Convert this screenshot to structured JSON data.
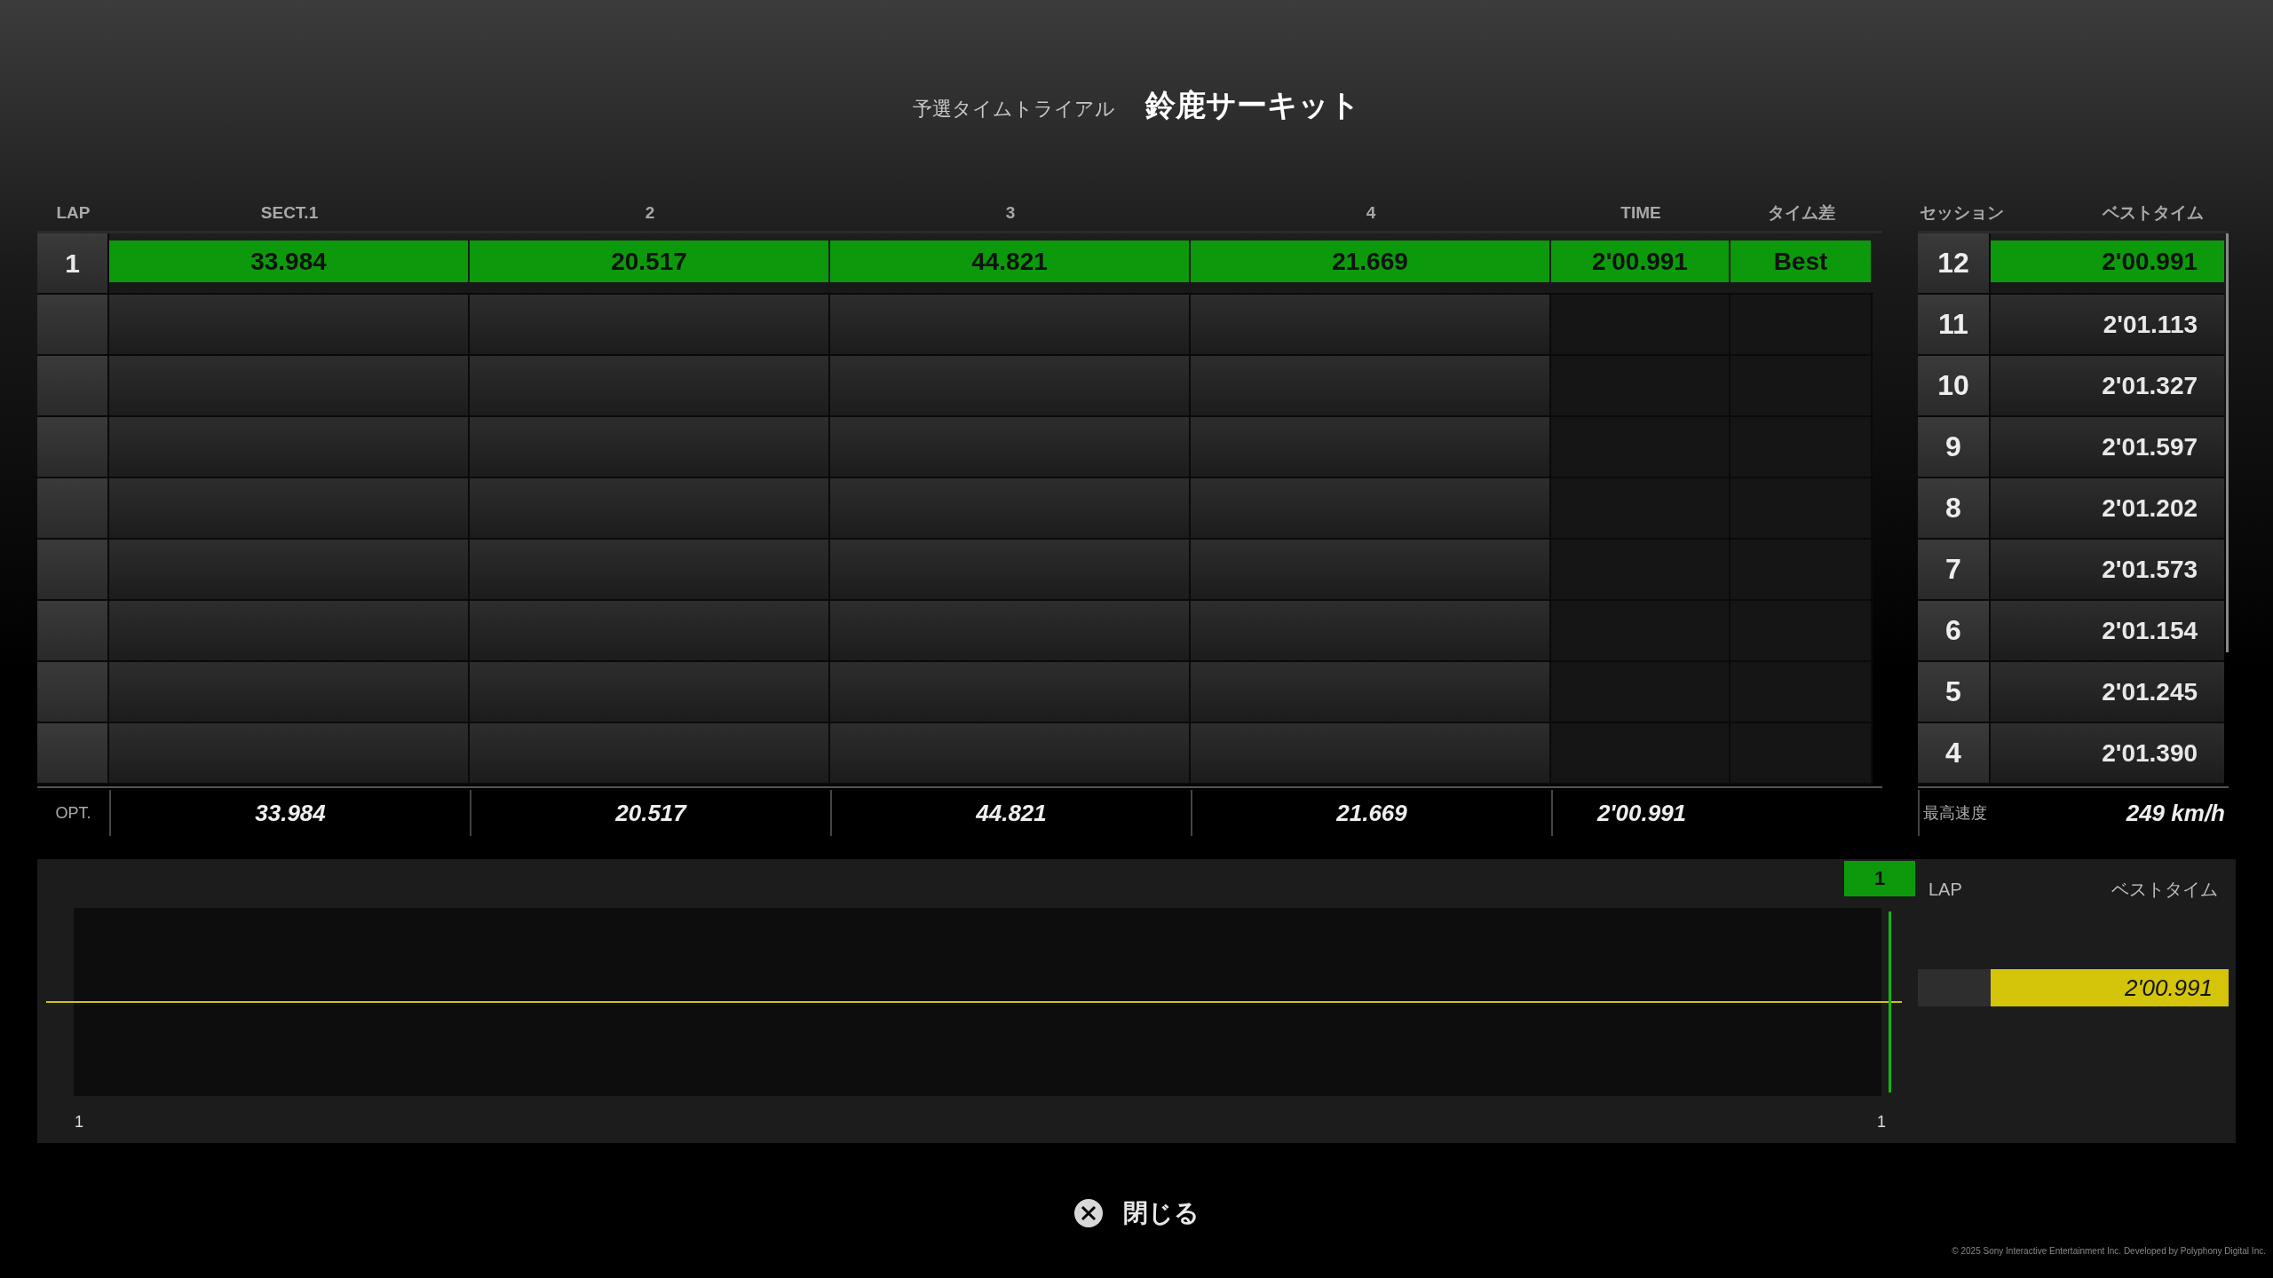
{
  "title": {
    "mode": "予選タイムトライアル",
    "track": "鈴鹿サーキット"
  },
  "lap_table": {
    "columns": [
      "LAP",
      "SECT.1",
      "2",
      "3",
      "4",
      "TIME",
      "タイム差"
    ],
    "rows": [
      {
        "kind": "lap",
        "lap": "1",
        "sectors": [
          "33.984",
          "20.517",
          "44.821",
          "21.669"
        ],
        "time": "2'00.991",
        "diff": "Best",
        "best": true
      },
      {
        "kind": "empty"
      },
      {
        "kind": "empty"
      },
      {
        "kind": "empty"
      },
      {
        "kind": "empty"
      },
      {
        "kind": "empty"
      },
      {
        "kind": "empty"
      },
      {
        "kind": "empty"
      },
      {
        "kind": "empty"
      }
    ],
    "optimal": {
      "label": "OPT.",
      "sectors": [
        "33.984",
        "20.517",
        "44.821",
        "21.669"
      ],
      "time": "2'00.991"
    }
  },
  "sessions": {
    "columns": [
      "セッション",
      "ベストタイム"
    ],
    "rows": [
      {
        "session": "12",
        "time": "2'00.991",
        "best": true
      },
      {
        "session": "11",
        "time": "2'01.113",
        "best": false
      },
      {
        "session": "10",
        "time": "2'01.327",
        "best": false
      },
      {
        "session": "9",
        "time": "2'01.597",
        "best": false
      },
      {
        "session": "8",
        "time": "2'01.202",
        "best": false
      },
      {
        "session": "7",
        "time": "2'01.573",
        "best": false
      },
      {
        "session": "6",
        "time": "2'01.154",
        "best": false
      },
      {
        "session": "5",
        "time": "2'01.245",
        "best": false
      },
      {
        "session": "4",
        "time": "2'01.390",
        "best": false
      }
    ],
    "top_speed": {
      "label": "最高速度",
      "value": "249 km/h"
    }
  },
  "lap_chart": {
    "marker": "1",
    "x_labels": [
      "1",
      "1"
    ],
    "legend": {
      "columns": [
        "LAP",
        "ベストタイム"
      ],
      "rows": [
        {
          "time": "2'00.991",
          "color": "#d4c40a"
        }
      ]
    }
  },
  "close_button": "閉じる",
  "copyright": "© 2025 Sony Interactive Entertainment Inc. Developed by Polyphony Digital Inc."
}
